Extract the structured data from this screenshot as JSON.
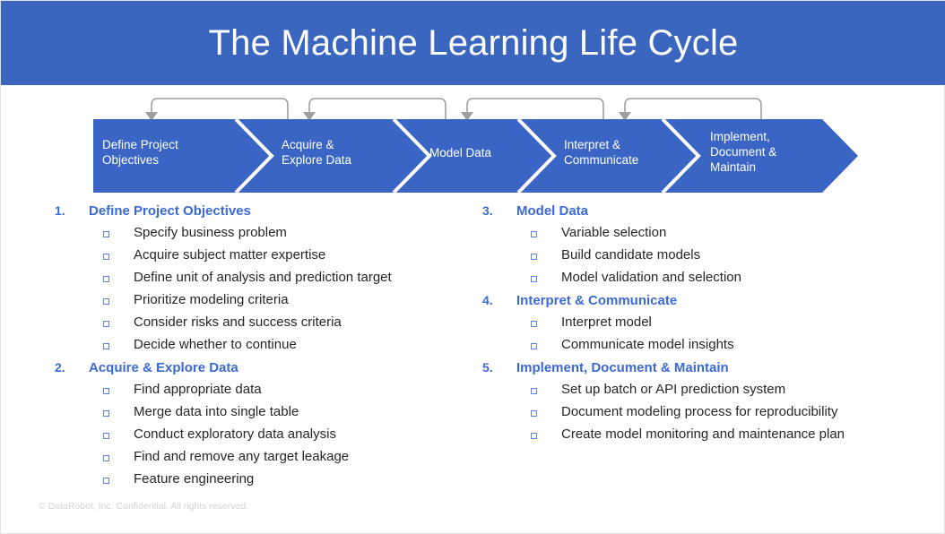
{
  "header": {
    "title": "The Machine Learning Life Cycle",
    "background_color": "#3a66c0",
    "text_color": "#ffffff"
  },
  "flow": {
    "chevron_color": "#3a65c4",
    "separator_color": "#ffffff",
    "feedback_arrow_color": "#9e9e9e",
    "stages": [
      {
        "label": "Define Project\nObjectives"
      },
      {
        "label": "Acquire &\nExplore Data"
      },
      {
        "label": "Model Data"
      },
      {
        "label": "Interpret &\nCommunicate"
      },
      {
        "label": "Implement,\nDocument &\nMaintain"
      }
    ],
    "feedback_loops": 4
  },
  "lists": {
    "heading_color": "#3b6ad4",
    "bullet_color": "#5b84d8",
    "text_color": "#262626",
    "left": [
      {
        "number": "1.",
        "title": "Define Project Objectives",
        "items": [
          "Specify business problem",
          "Acquire subject matter expertise",
          "Define unit of analysis and prediction target",
          "Prioritize modeling criteria",
          "Consider risks and success criteria",
          "Decide whether to continue"
        ]
      },
      {
        "number": "2.",
        "title": "Acquire & Explore Data",
        "items": [
          "Find appropriate data",
          "Merge data into single table",
          "Conduct exploratory data analysis",
          "Find and remove any target leakage",
          "Feature engineering"
        ]
      }
    ],
    "right": [
      {
        "number": "3.",
        "title": "Model Data",
        "items": [
          "Variable selection",
          "Build candidate models",
          "Model validation and selection"
        ]
      },
      {
        "number": "4.",
        "title": "Interpret & Communicate",
        "items": [
          "Interpret model",
          "Communicate model insights"
        ]
      },
      {
        "number": "5.",
        "title": "Implement, Document & Maintain",
        "items": [
          "Set up batch or API prediction system",
          "Document modeling process for reproducibility",
          "Create model monitoring and maintenance plan"
        ]
      }
    ]
  },
  "footer": {
    "text": "© DataRobot, Inc. Confidential. All rights reserved."
  }
}
